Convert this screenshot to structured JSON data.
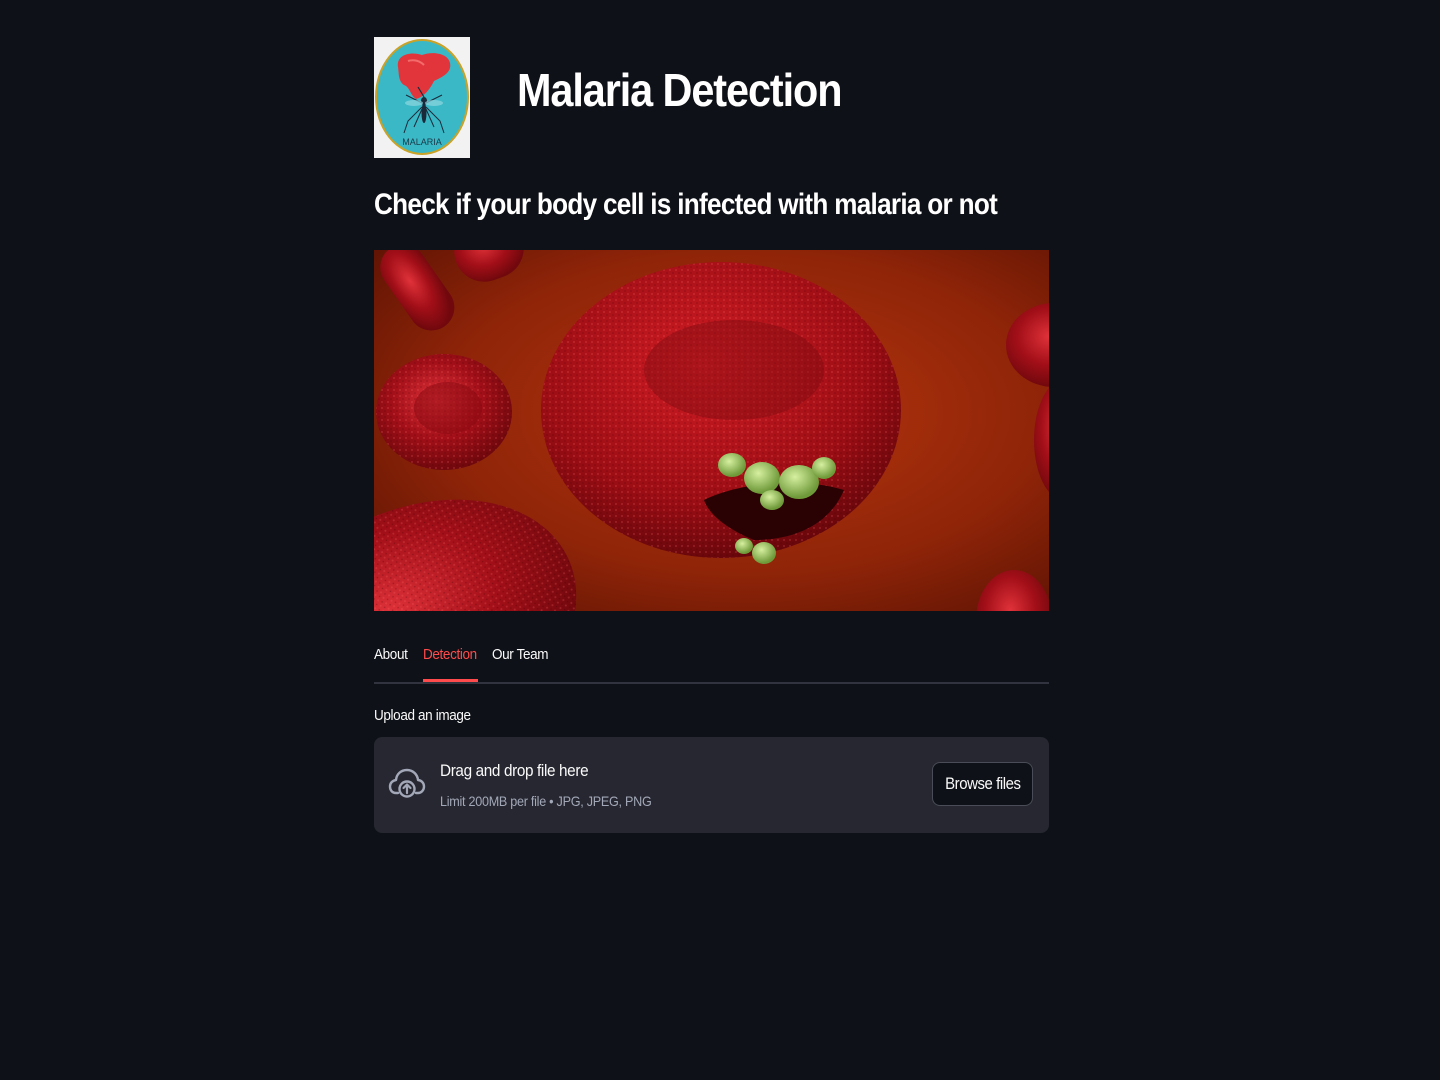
{
  "app": {
    "title": "Malaria Detection",
    "subtitle": "Check if your body cell is infected with malaria or not",
    "logo_text": "MALARIA"
  },
  "tabs": [
    {
      "label": "About",
      "active": false
    },
    {
      "label": "Detection",
      "active": true
    },
    {
      "label": "Our Team",
      "active": false
    }
  ],
  "uploader": {
    "label": "Upload an image",
    "drop_title": "Drag and drop file here",
    "limit_text": "Limit 200MB per file • JPG, JPEG, PNG",
    "browse_label": "Browse files",
    "icon": "cloud-upload-icon"
  },
  "colors": {
    "background": "#0e1117",
    "accent": "#ff4b4b",
    "dropzone": "#262730"
  }
}
